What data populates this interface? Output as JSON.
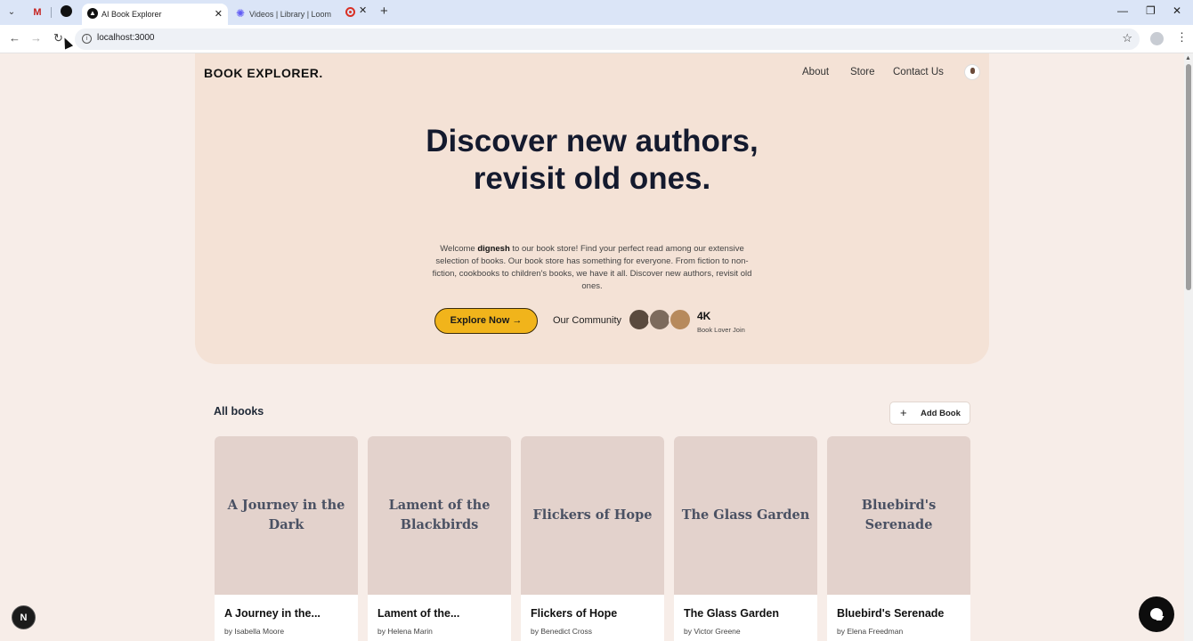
{
  "browser": {
    "tabs": [
      {
        "title": "AI Book Explorer",
        "close": "✕"
      },
      {
        "title": "Videos | Library | Loom",
        "close": "✕"
      }
    ],
    "url": "localhost:3000",
    "window_controls": {
      "minimize": "—",
      "restore": "❐",
      "close": "✕"
    }
  },
  "nav": {
    "brand": "BOOK EXPLORER.",
    "links": [
      "About",
      "Store",
      "Contact Us"
    ]
  },
  "hero": {
    "headline": "Discover new authors, revisit old ones.",
    "welcome_prefix": "Welcome ",
    "user": "dignesh",
    "welcome_text": " to our book store! Find your perfect read among our extensive selection of books. Our book store has something for everyone. From fiction to non-fiction, cookbooks to children's books, we have it all. Discover new authors, revisit old ones.",
    "cta": "Explore Now",
    "cta_icon": "→",
    "community_label": "Our Community",
    "community_count": "4K",
    "community_caption": "Book Lover Join"
  },
  "books_section": {
    "title": "All books",
    "add_button": "Add Book",
    "books": [
      {
        "cover": "A Journey in the Dark",
        "title": "A Journey in the...",
        "author": "by Isabella Moore"
      },
      {
        "cover": "Lament of the Blackbirds",
        "title": "Lament of the...",
        "author": "by Helena Marin"
      },
      {
        "cover": "Flickers of Hope",
        "title": "Flickers of Hope",
        "author": "by Benedict Cross"
      },
      {
        "cover": "The Glass Garden",
        "title": "The Glass Garden",
        "author": "by Victor Greene"
      },
      {
        "cover": "Bluebird's Serenade",
        "title": "Bluebird's Serenade",
        "author": "by Elena Freedman"
      }
    ]
  },
  "dev_badge": "N",
  "colors": {
    "page_bg": "#f7ede8",
    "hero_bg": "#f4e2d6",
    "accent": "#f1b41b",
    "cover_bg": "#e3d2cc",
    "headline": "#141a2e"
  }
}
